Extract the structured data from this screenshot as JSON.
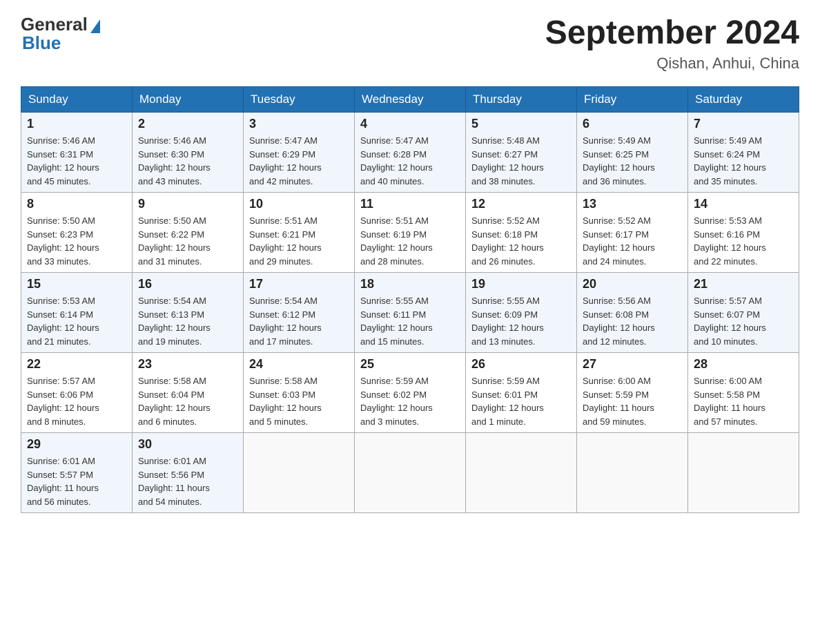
{
  "logo": {
    "general": "General",
    "blue": "Blue"
  },
  "title": "September 2024",
  "subtitle": "Qishan, Anhui, China",
  "headers": [
    "Sunday",
    "Monday",
    "Tuesday",
    "Wednesday",
    "Thursday",
    "Friday",
    "Saturday"
  ],
  "weeks": [
    [
      {
        "day": "1",
        "sunrise": "5:46 AM",
        "sunset": "6:31 PM",
        "daylight": "12 hours and 45 minutes."
      },
      {
        "day": "2",
        "sunrise": "5:46 AM",
        "sunset": "6:30 PM",
        "daylight": "12 hours and 43 minutes."
      },
      {
        "day": "3",
        "sunrise": "5:47 AM",
        "sunset": "6:29 PM",
        "daylight": "12 hours and 42 minutes."
      },
      {
        "day": "4",
        "sunrise": "5:47 AM",
        "sunset": "6:28 PM",
        "daylight": "12 hours and 40 minutes."
      },
      {
        "day": "5",
        "sunrise": "5:48 AM",
        "sunset": "6:27 PM",
        "daylight": "12 hours and 38 minutes."
      },
      {
        "day": "6",
        "sunrise": "5:49 AM",
        "sunset": "6:25 PM",
        "daylight": "12 hours and 36 minutes."
      },
      {
        "day": "7",
        "sunrise": "5:49 AM",
        "sunset": "6:24 PM",
        "daylight": "12 hours and 35 minutes."
      }
    ],
    [
      {
        "day": "8",
        "sunrise": "5:50 AM",
        "sunset": "6:23 PM",
        "daylight": "12 hours and 33 minutes."
      },
      {
        "day": "9",
        "sunrise": "5:50 AM",
        "sunset": "6:22 PM",
        "daylight": "12 hours and 31 minutes."
      },
      {
        "day": "10",
        "sunrise": "5:51 AM",
        "sunset": "6:21 PM",
        "daylight": "12 hours and 29 minutes."
      },
      {
        "day": "11",
        "sunrise": "5:51 AM",
        "sunset": "6:19 PM",
        "daylight": "12 hours and 28 minutes."
      },
      {
        "day": "12",
        "sunrise": "5:52 AM",
        "sunset": "6:18 PM",
        "daylight": "12 hours and 26 minutes."
      },
      {
        "day": "13",
        "sunrise": "5:52 AM",
        "sunset": "6:17 PM",
        "daylight": "12 hours and 24 minutes."
      },
      {
        "day": "14",
        "sunrise": "5:53 AM",
        "sunset": "6:16 PM",
        "daylight": "12 hours and 22 minutes."
      }
    ],
    [
      {
        "day": "15",
        "sunrise": "5:53 AM",
        "sunset": "6:14 PM",
        "daylight": "12 hours and 21 minutes."
      },
      {
        "day": "16",
        "sunrise": "5:54 AM",
        "sunset": "6:13 PM",
        "daylight": "12 hours and 19 minutes."
      },
      {
        "day": "17",
        "sunrise": "5:54 AM",
        "sunset": "6:12 PM",
        "daylight": "12 hours and 17 minutes."
      },
      {
        "day": "18",
        "sunrise": "5:55 AM",
        "sunset": "6:11 PM",
        "daylight": "12 hours and 15 minutes."
      },
      {
        "day": "19",
        "sunrise": "5:55 AM",
        "sunset": "6:09 PM",
        "daylight": "12 hours and 13 minutes."
      },
      {
        "day": "20",
        "sunrise": "5:56 AM",
        "sunset": "6:08 PM",
        "daylight": "12 hours and 12 minutes."
      },
      {
        "day": "21",
        "sunrise": "5:57 AM",
        "sunset": "6:07 PM",
        "daylight": "12 hours and 10 minutes."
      }
    ],
    [
      {
        "day": "22",
        "sunrise": "5:57 AM",
        "sunset": "6:06 PM",
        "daylight": "12 hours and 8 minutes."
      },
      {
        "day": "23",
        "sunrise": "5:58 AM",
        "sunset": "6:04 PM",
        "daylight": "12 hours and 6 minutes."
      },
      {
        "day": "24",
        "sunrise": "5:58 AM",
        "sunset": "6:03 PM",
        "daylight": "12 hours and 5 minutes."
      },
      {
        "day": "25",
        "sunrise": "5:59 AM",
        "sunset": "6:02 PM",
        "daylight": "12 hours and 3 minutes."
      },
      {
        "day": "26",
        "sunrise": "5:59 AM",
        "sunset": "6:01 PM",
        "daylight": "12 hours and 1 minute."
      },
      {
        "day": "27",
        "sunrise": "6:00 AM",
        "sunset": "5:59 PM",
        "daylight": "11 hours and 59 minutes."
      },
      {
        "day": "28",
        "sunrise": "6:00 AM",
        "sunset": "5:58 PM",
        "daylight": "11 hours and 57 minutes."
      }
    ],
    [
      {
        "day": "29",
        "sunrise": "6:01 AM",
        "sunset": "5:57 PM",
        "daylight": "11 hours and 56 minutes."
      },
      {
        "day": "30",
        "sunrise": "6:01 AM",
        "sunset": "5:56 PM",
        "daylight": "11 hours and 54 minutes."
      },
      null,
      null,
      null,
      null,
      null
    ]
  ],
  "labels": {
    "sunrise": "Sunrise:",
    "sunset": "Sunset:",
    "daylight": "Daylight:"
  }
}
